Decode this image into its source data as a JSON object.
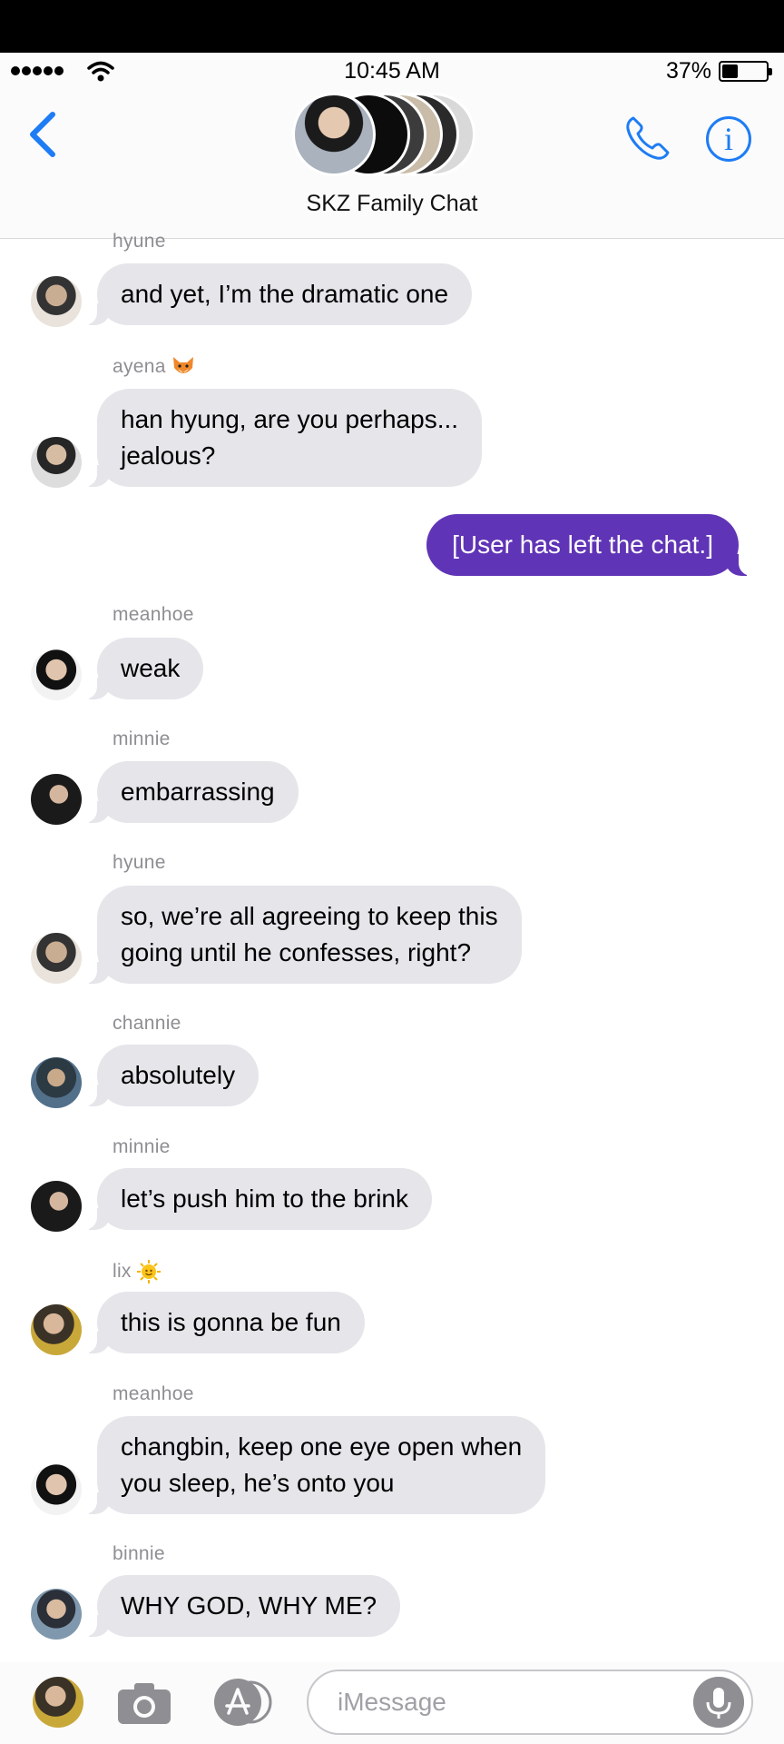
{
  "status_bar": {
    "time": "10:45 AM",
    "battery_percent": "37%",
    "battery_level": 0.37
  },
  "header": {
    "back_icon": "chevron-left-icon",
    "title": "SKZ Family Chat",
    "phone_icon": "phone-icon",
    "info_icon": "info-icon",
    "info_glyph": "i"
  },
  "messages": [
    {
      "sender": "hyune",
      "text": "and yet, I’m the dramatic one"
    },
    {
      "sender": "ayena",
      "sender_emoji": "fox-emoji",
      "text": "han hyung, are you perhaps...\njealous?"
    },
    {
      "outgoing": true,
      "text": "[User has left the chat.]"
    },
    {
      "sender": "meanhoe",
      "text": "weak"
    },
    {
      "sender": "minnie",
      "text": "embarrassing"
    },
    {
      "sender": "hyune",
      "text": "so, we’re all agreeing to keep this\ngoing until he confesses, right?"
    },
    {
      "sender": "channie",
      "text": "absolutely"
    },
    {
      "sender": "minnie",
      "text": "let’s push him to the brink"
    },
    {
      "sender": "lix",
      "sender_emoji": "sun-emoji",
      "text": "this is gonna be fun"
    },
    {
      "sender": "meanhoe",
      "text": "changbin, keep one eye open when\nyou sleep, he’s onto you"
    },
    {
      "sender": "binnie",
      "text": "WHY GOD, WHY ME?"
    }
  ],
  "composer": {
    "placeholder": "iMessage",
    "camera_icon": "camera-icon",
    "appstore_icon": "app-store-icon",
    "mic_icon": "microphone-icon"
  },
  "colors": {
    "accent": "#1e7cf5",
    "outgoing_bubble": "#6034b6",
    "incoming_bubble": "#e5e5ea",
    "sender_label": "#8e8e93"
  }
}
